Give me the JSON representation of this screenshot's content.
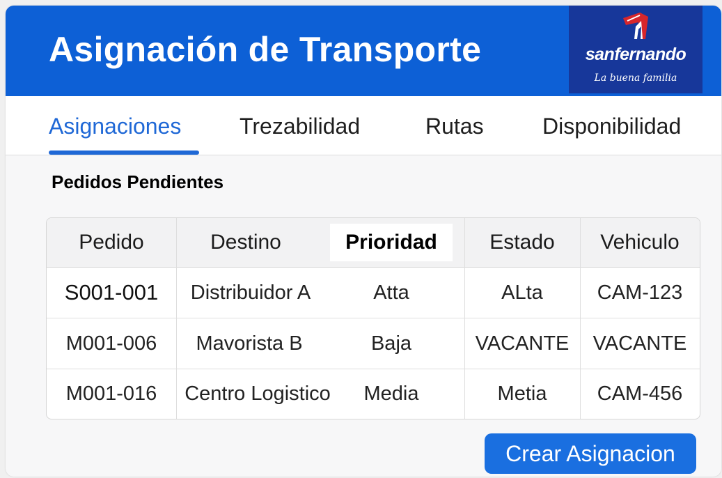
{
  "header": {
    "title": "Asignación de Transporte",
    "logo": {
      "wordmark": "sanfernando",
      "tagline": "La buena familia"
    }
  },
  "tabs": [
    {
      "label": "Asignaciones",
      "active": true
    },
    {
      "label": "Trezabilidad",
      "active": false
    },
    {
      "label": "Rutas",
      "active": false
    },
    {
      "label": "Disponibilidad",
      "active": false
    }
  ],
  "section": {
    "title": "Pedidos Pendientes"
  },
  "table": {
    "columns": [
      "Pedido",
      "Destino",
      "Prioridad",
      "Estado",
      "Vehiculo"
    ],
    "rows": [
      [
        "S001-001",
        "Distribuidor A",
        "Atta",
        "ALta",
        "CAM-123"
      ],
      [
        "M001-006",
        "Mavorista B",
        "Baja",
        "VACANTE",
        "VACANTE"
      ],
      [
        "M001-016",
        "Centro Logistico",
        "Media",
        "Metia",
        "CAM-456"
      ]
    ]
  },
  "actions": {
    "create_label": "Crear Asignacion"
  },
  "colors": {
    "header_bg": "#0d60d6",
    "logo_bg": "#17379a",
    "accent": "#1f68d6",
    "button_bg": "#1a6fe0"
  }
}
